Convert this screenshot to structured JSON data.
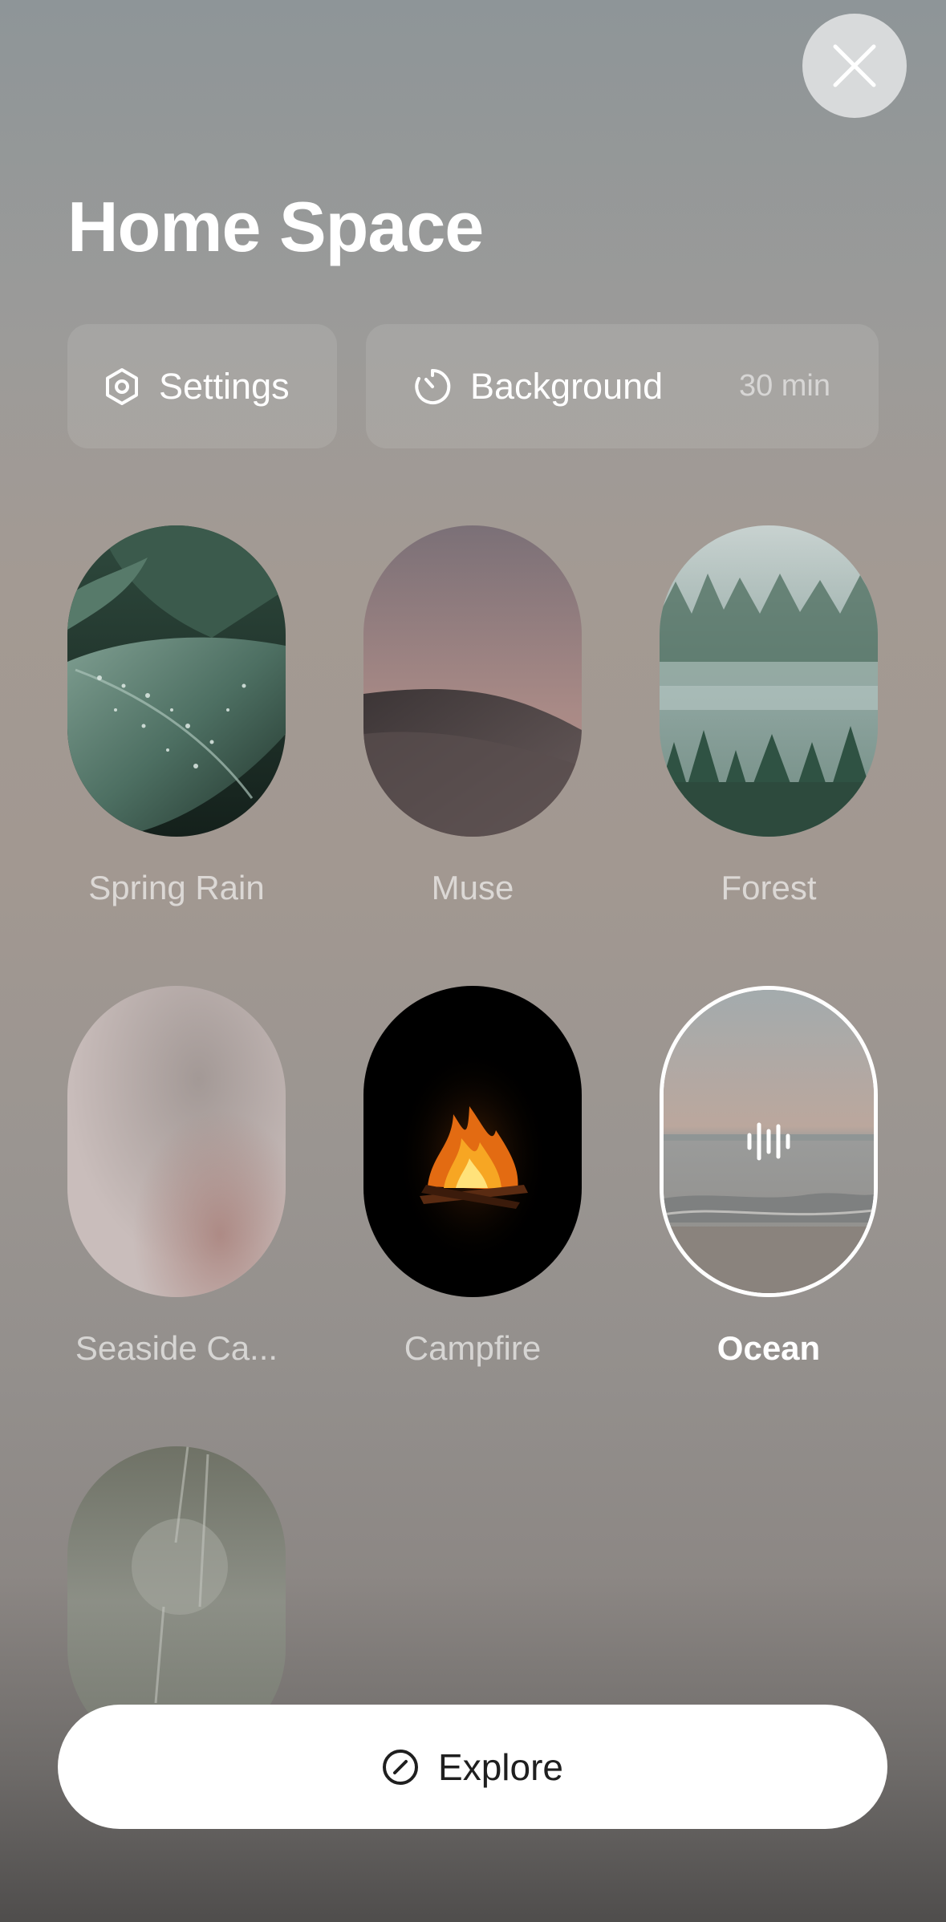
{
  "title": "Home Space",
  "close_icon": "close-icon",
  "chips": {
    "settings": {
      "label": "Settings",
      "icon": "gear-hexagon-icon"
    },
    "background": {
      "label": "Background",
      "value": "30 min",
      "icon": "timer-icon"
    }
  },
  "sounds": [
    {
      "name": "Spring Rain",
      "selected": false
    },
    {
      "name": "Muse",
      "selected": false
    },
    {
      "name": "Forest",
      "selected": false
    },
    {
      "name": "Seaside Ca...",
      "selected": false
    },
    {
      "name": "Campfire",
      "selected": false
    },
    {
      "name": "Ocean",
      "selected": true,
      "overlay_icon": "waveform-icon"
    },
    {
      "name": "",
      "selected": false
    }
  ],
  "explore": {
    "label": "Explore",
    "icon": "compass-icon"
  }
}
